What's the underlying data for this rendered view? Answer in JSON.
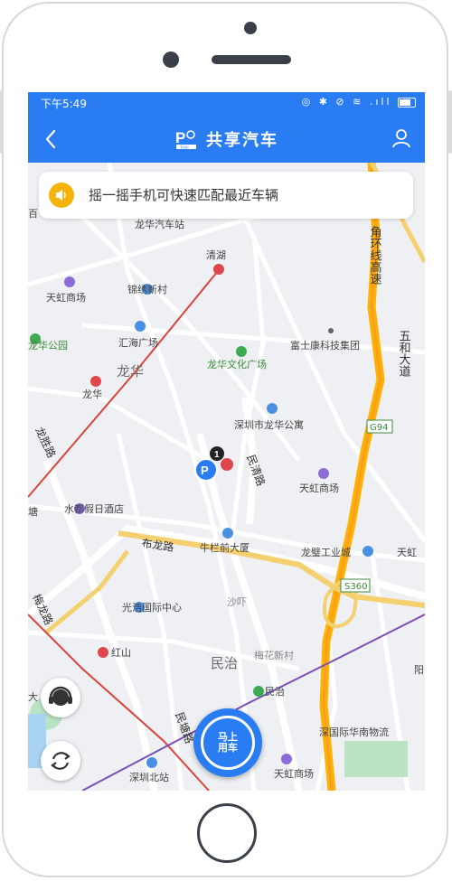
{
  "status_bar": {
    "time": "下午5:49",
    "icons": "◎ ✱ ⊘ ≋ .ıll"
  },
  "header": {
    "title": "共享汽车",
    "logo_text": "TAXI"
  },
  "notice": {
    "text": "摇一摇手机可快速匹配最近车辆"
  },
  "map": {
    "badge_count": "1",
    "road_shields": [
      "G94",
      "S360"
    ],
    "labels": {
      "l1": "龙华汽车站",
      "l2": "清湖",
      "l3": "天虹商场",
      "l4": "锦绣新村",
      "l5": "汇海广场",
      "l6": "龙华公园",
      "l7": "龙华",
      "l8": "龙华",
      "l9": "龙华文化广场",
      "l10": "富士康科技集团",
      "l11": "深圳市龙华公寓",
      "l12": "天虹商场",
      "l13": "水都假日酒店",
      "l14": "牛栏前大厦",
      "l15": "龙璧工业城",
      "l16": "天虹",
      "l17": "光浩国际中心",
      "l18": "沙吓",
      "l19": "红山",
      "l20": "民治",
      "l21": "梅花新村",
      "l22": "民治",
      "l23": "深圳北站",
      "l24": "深国际华南物流",
      "l25": "天虹商场",
      "l26": "阳",
      "l27": "塘",
      "l28": "大",
      "l29": "百",
      "road1": "布龙路",
      "road2": "民清路",
      "road3": "龙胜路",
      "road4": "梅龙路",
      "road5": "民塘路",
      "road6": "角环线高速",
      "road7": "五和大道"
    }
  },
  "actions": {
    "main_button": "马上\n用车",
    "main_line1": "马上",
    "main_line2": "用车"
  }
}
